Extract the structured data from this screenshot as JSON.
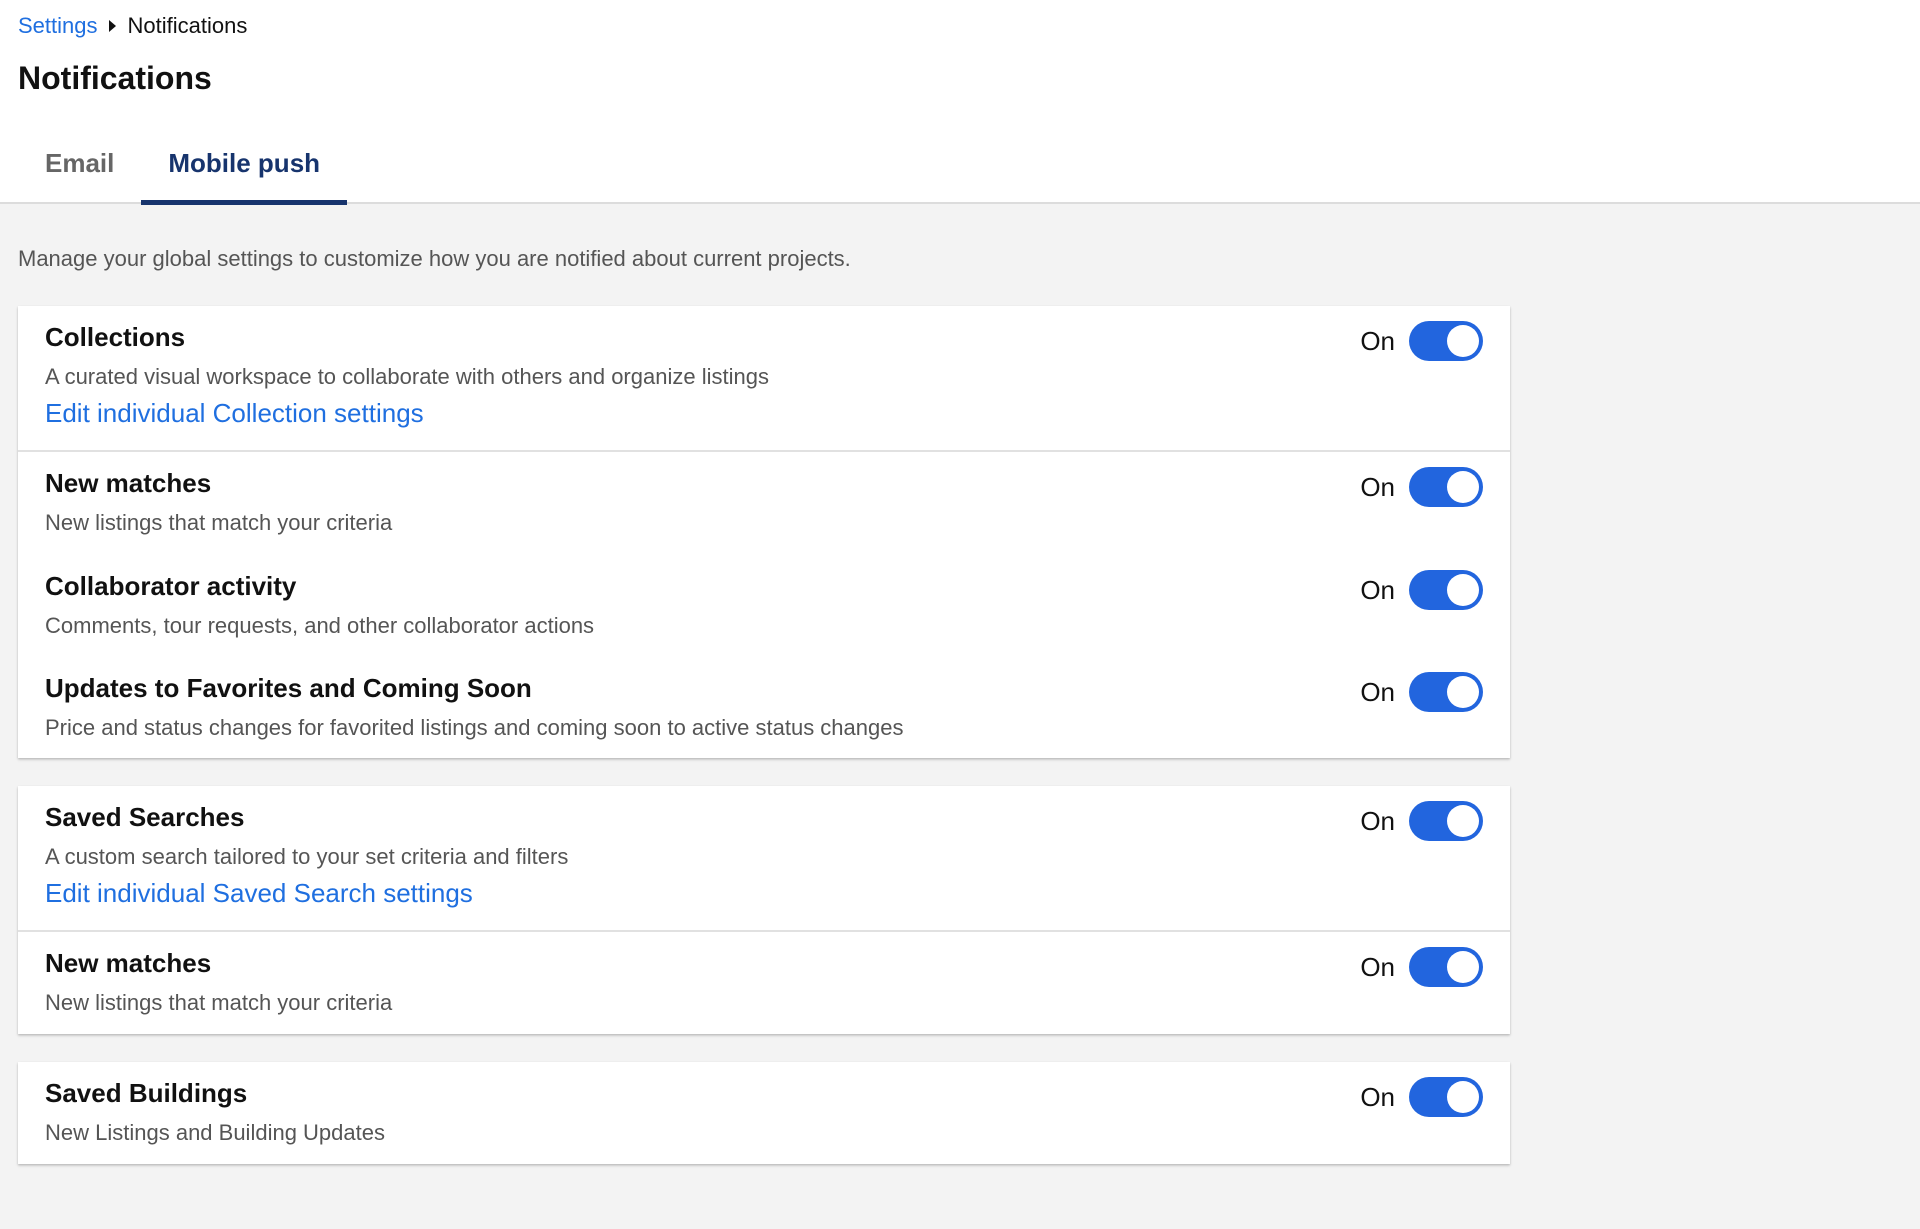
{
  "breadcrumb": {
    "parent": "Settings",
    "current": "Notifications"
  },
  "page": {
    "title": "Notifications",
    "intro": "Manage your global settings to customize how you are notified about current projects."
  },
  "tabs": [
    {
      "label": "Email",
      "active": false
    },
    {
      "label": "Mobile push",
      "active": true
    }
  ],
  "colors": {
    "accent": "#2265de",
    "link": "#1f6fe0",
    "active_tab": "#17346d",
    "background": "#f3f3f3"
  },
  "cards": [
    {
      "rows": [
        {
          "title": "Collections",
          "description": "A curated visual workspace to collaborate with others and organize listings",
          "link": "Edit individual Collection settings",
          "toggle_label": "On",
          "enabled": true
        },
        {
          "title": "New matches",
          "description": "New listings that match your criteria",
          "toggle_label": "On",
          "enabled": true
        },
        {
          "title": "Collaborator activity",
          "description": "Comments, tour requests, and other collaborator actions",
          "toggle_label": "On",
          "enabled": true
        },
        {
          "title": "Updates to Favorites and Coming Soon",
          "description": "Price and status changes for favorited listings and coming soon to active status changes",
          "toggle_label": "On",
          "enabled": true
        }
      ]
    },
    {
      "rows": [
        {
          "title": "Saved Searches",
          "description": "A custom search tailored to your set criteria and filters",
          "link": "Edit individual Saved Search settings",
          "toggle_label": "On",
          "enabled": true
        },
        {
          "title": "New matches",
          "description": "New listings that match your criteria",
          "toggle_label": "On",
          "enabled": true
        }
      ]
    },
    {
      "rows": [
        {
          "title": "Saved Buildings",
          "description": "New Listings and Building Updates",
          "toggle_label": "On",
          "enabled": true
        }
      ]
    }
  ]
}
